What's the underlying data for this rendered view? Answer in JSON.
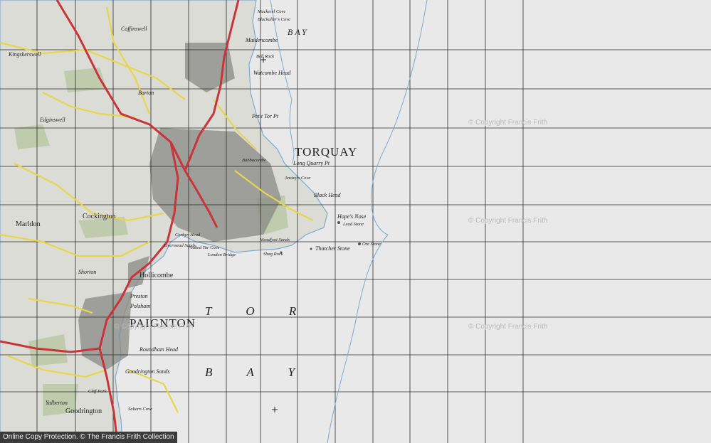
{
  "map": {
    "labels": {
      "torquay": "TORQUAY",
      "paignton": "PAIGNTON",
      "tor_sea": "T O R",
      "bay_sea": "B A Y",
      "bay_top": "BAY",
      "cockington": "Cockington",
      "maidencombe": "Maidencombe",
      "watcombe_head": "Watcombe Head",
      "bell_rock": "Bell Rock",
      "petit_tor_pt": "Petit Tor Pt",
      "long_quarry_pt": "Long Quarry Pt",
      "anstey_cove": "Anstey's Cove",
      "black_head": "Black Head",
      "hopes_nose": "Hope's Nose",
      "lead_stone": "Lead Stone",
      "ore_stone": "Ore Stone",
      "thatcher_stone": "Thatcher Stone",
      "meadfoot_sands": "Meadfoot Sands",
      "shag_rock": "Shag Rock",
      "peaked_tor_cove": "Peaked Tor Cove",
      "london_bridge": "London Bridge",
      "corbyn_head": "Corbyn Head",
      "livermead_sands": "Livermead Sands",
      "hollicombe": "Hollicombe",
      "preston": "Preston",
      "polsham": "Polsham",
      "roundham_head": "Roundham Head",
      "goodrington_sands": "Goodrington Sands",
      "goodrington": "Goodrington",
      "cliff_park": "Cliff Park",
      "saltern_cove": "Saltern Cove",
      "yalberton": "Yalberton",
      "marldon": "Marldon",
      "shorton": "Shorton",
      "coffinswell": "Coffinswell",
      "kingskerswell": "Kingskerswell",
      "edginswell": "Edginswell",
      "barton": "Barton",
      "babbacombe": "Babbacombe",
      "mackerel_cove": "Mackerel Cove",
      "blackaller_cove": "Blackaller's Cove"
    },
    "watermarks": [
      "© Copyright Francis Frith",
      "© Copyright Francis Frith",
      "© Copyright Francis Frith",
      "© Copyright Francis Frith"
    ],
    "colors": {
      "sea": "#e9e9e9",
      "land": "#dcdcd6",
      "urban": "#8a8a86",
      "road_a": "#c8343a",
      "road_b": "#e7d64a",
      "grid": "#2a2a2a",
      "coast_blue": "#7fa8cf",
      "green": "#b9c7a3"
    }
  },
  "footer": {
    "text": "Online Copy Protection. © The Francis Frith Collection"
  }
}
